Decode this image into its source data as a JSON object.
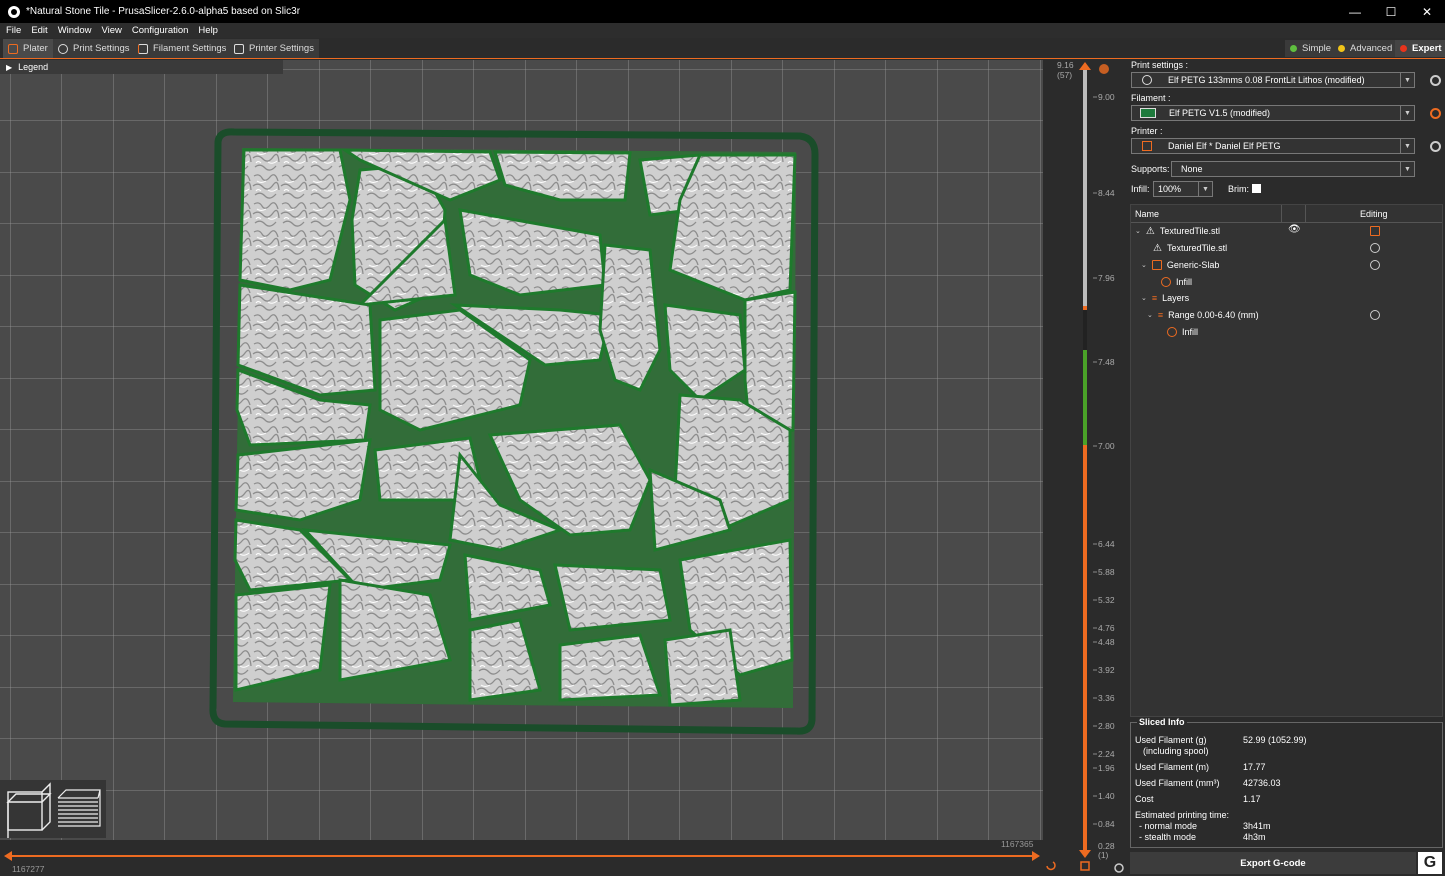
{
  "titlebar": {
    "title": "*Natural Stone Tile - PrusaSlicer-2.6.0-alpha5 based on Slic3r",
    "minimize": "—",
    "maximize": "☐",
    "close": "✕"
  },
  "menu": [
    "File",
    "Edit",
    "Window",
    "View",
    "Configuration",
    "Help"
  ],
  "tabs": [
    "Plater",
    "Print Settings",
    "Filament Settings",
    "Printer Settings"
  ],
  "modes": {
    "simple": "Simple",
    "advanced": "Advanced",
    "expert": "Expert",
    "colors": {
      "simple": "#5fbf3f",
      "advanced": "#f0c419",
      "expert": "#e8341c"
    }
  },
  "viewport": {
    "legend": "Legend",
    "legend_arrow": "▶",
    "hslider_left": "1167277",
    "hslider_right": "1167365"
  },
  "vslider": {
    "top_value": "9.16",
    "top_layer": "(57)",
    "bottom_value": "0.28",
    "bottom_layer": "(1)",
    "ticks": [
      "9.00",
      "8.44",
      "7.96",
      "7.48",
      "7.00",
      "6.44",
      "5.88",
      "5.32",
      "4.76",
      "4.48",
      "3.92",
      "3.36",
      "2.80",
      "2.24",
      "1.96",
      "1.40",
      "0.84"
    ]
  },
  "sidebar": {
    "print_settings_label": "Print settings :",
    "print_settings_value": "Elf PETG 133mms 0.08 FrontLit Lithos (modified)",
    "filament_label": "Filament :",
    "filament_value": "Elf PETG V1.5 (modified)",
    "filament_color": "#1e7a3c",
    "printer_label": "Printer :",
    "printer_value": "Daniel Elf * Daniel Elf PETG",
    "supports_label": "Supports:",
    "supports_value": "None",
    "infill_label": "Infill:",
    "infill_value": "100%",
    "brim_label": "Brim:",
    "columns": {
      "name": "Name",
      "editing": "Editing"
    },
    "tree": {
      "object": "TexturedTile.stl",
      "part": "TexturedTile.stl",
      "modifier": "Generic-Slab",
      "modifier_setting": "Infill",
      "layers": "Layers",
      "range": "Range 0.00-6.40 (mm)",
      "range_setting": "Infill"
    }
  },
  "sliced_info": {
    "title": "Sliced Info",
    "used_filament_g_label": "Used Filament (g)",
    "including_spool": "(including spool)",
    "used_filament_g": "52.99 (1052.99)",
    "used_filament_m_label": "Used Filament (m)",
    "used_filament_m": "17.77",
    "used_filament_mm3_label": "Used Filament (mm³)",
    "used_filament_mm3": "42736.03",
    "cost_label": "Cost",
    "cost": "1.17",
    "est_time_label": "Estimated printing time:",
    "normal_mode_label": "- normal mode",
    "normal_mode": "3h41m",
    "stealth_mode_label": "- stealth mode",
    "stealth_mode": "4h3m"
  },
  "export_button": "Export G-code",
  "export_icon_letter": "G"
}
